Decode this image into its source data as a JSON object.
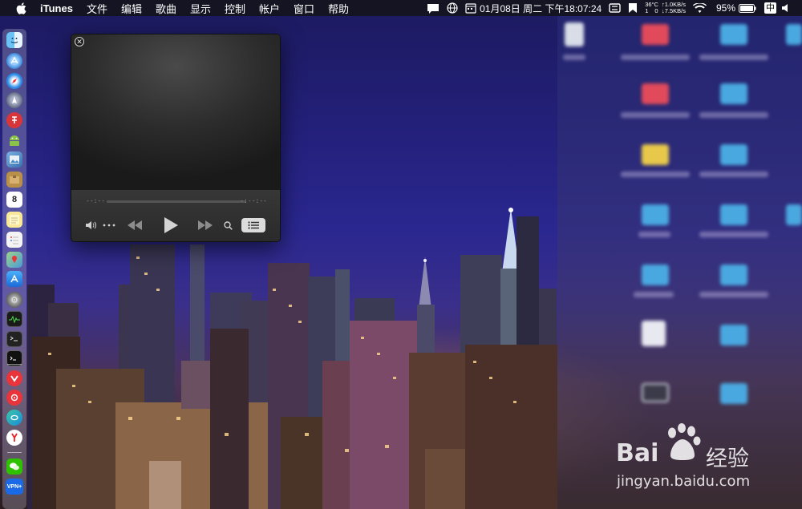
{
  "menubar": {
    "app_name": "iTunes",
    "menus": [
      "文件",
      "编辑",
      "歌曲",
      "显示",
      "控制",
      "帐户",
      "窗口",
      "帮助"
    ],
    "status": {
      "datetime": "01月08日 周二 下午18:07:24",
      "temperature": "36°C",
      "net_up": "↑1.0KB/s",
      "net_down": "↓7.5KB/s",
      "net_up_count": "1",
      "net_down_count": "0",
      "battery": "95%",
      "input_method": "中"
    }
  },
  "player": {
    "elapsed": "--:--",
    "remaining": "-:--:--",
    "icons": {
      "close": "close-icon",
      "volume": "volume-icon",
      "more": "more-icon",
      "rewind": "rewind-icon",
      "play": "play-icon",
      "fast_forward": "fast-forward-icon",
      "search": "search-icon",
      "up_next": "list-icon"
    }
  },
  "dock": {
    "calendar_day": "8",
    "vpn_label": "VPN+"
  },
  "watermark": {
    "brand": "Bai",
    "product": "经验",
    "url": "jingyan.baidu.com"
  },
  "colors": {
    "menubar_bg": "#14141e",
    "player_bg": "#2b2b2b",
    "sky": "#23207a"
  }
}
